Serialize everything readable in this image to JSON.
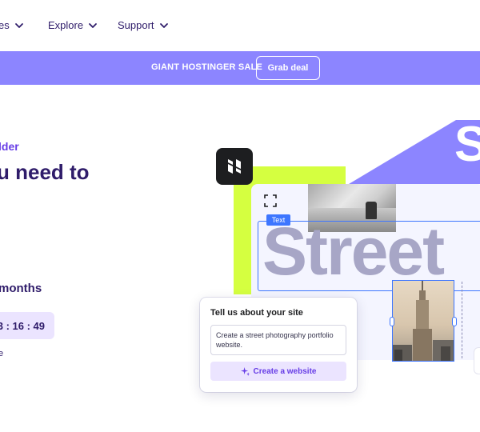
{
  "nav": {
    "items": [
      {
        "label": "es",
        "icon": "chevron-down-icon"
      },
      {
        "label": "Explore",
        "icon": "chevron-down-icon"
      },
      {
        "label": "Support",
        "icon": "chevron-down-icon"
      }
    ]
  },
  "banner": {
    "text": "GIANT HOSTINGER SALE",
    "button_label": "Grab deal"
  },
  "hero": {
    "eyebrow": "lder",
    "headline": "u need to",
    "months": "months",
    "timer": "3 : 16 : 49",
    "small_mark": "e"
  },
  "illustration": {
    "big_text": "Street",
    "text_tag": "Text",
    "big_letter": "S"
  },
  "prompt_card": {
    "title": "Tell us about your site",
    "input_value": "Create a street photography portfolio website.",
    "button_label": "Create a website",
    "button_icon": "sparkle-icon"
  },
  "colors": {
    "brand_purple": "#673de6",
    "banner_bg": "#8c85ff",
    "lime": "#d5ff40",
    "selection_blue": "#3d76ff",
    "dark": "#2f1c6a"
  }
}
